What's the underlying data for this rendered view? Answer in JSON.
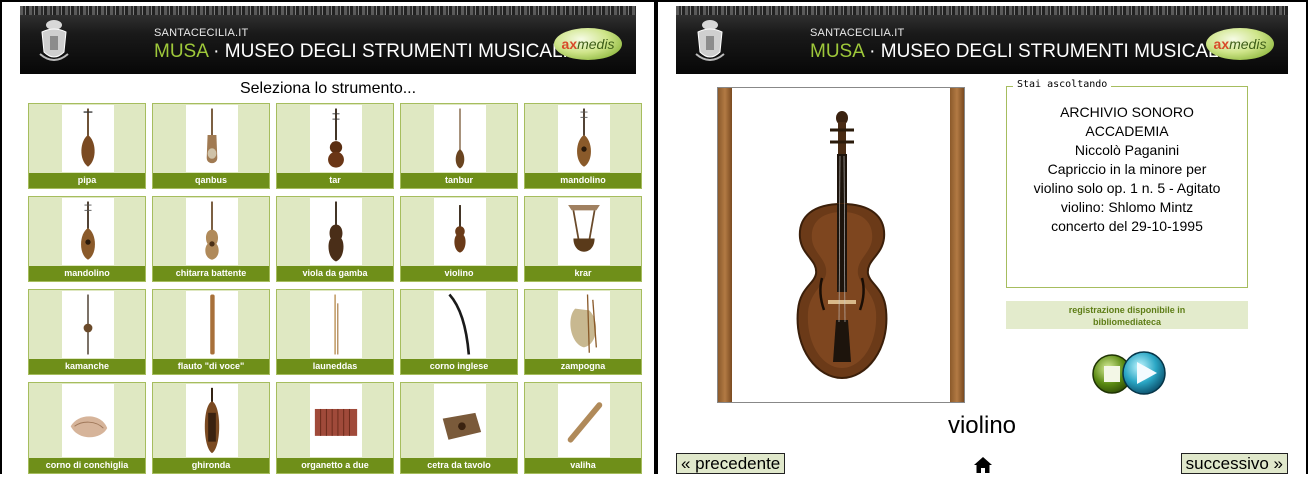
{
  "colors": {
    "tile_bg": "#dfe8c2",
    "tile_label_bg": "#6f8f19",
    "accent_green": "#9ec83a",
    "header_bg": "#111111",
    "nav_button_bg": "#e0e8cb"
  },
  "header": {
    "site": "SANTACECILIA.IT",
    "title_accent": "MUSA",
    "title_rest": " · MUSEO DEGLI STRUMENTI MUSICALI",
    "logo_x": "ax",
    "logo_rest": "medis",
    "crest_icon": "crest-icon"
  },
  "left": {
    "heading": "Seleziona lo strumento...",
    "instruments": [
      {
        "label": "pipa",
        "icon": "pipa-icon"
      },
      {
        "label": "qanbus",
        "icon": "qanbus-icon"
      },
      {
        "label": "tar",
        "icon": "tar-icon"
      },
      {
        "label": "tanbur",
        "icon": "tanbur-icon"
      },
      {
        "label": "mandolino",
        "icon": "mandolino-icon"
      },
      {
        "label": "mandolino",
        "icon": "mandolino-icon"
      },
      {
        "label": "chitarra battente",
        "icon": "chitarra-battente-icon"
      },
      {
        "label": "viola da gamba",
        "icon": "viola-da-gamba-icon"
      },
      {
        "label": "violino",
        "icon": "violino-icon"
      },
      {
        "label": "krar",
        "icon": "krar-icon"
      },
      {
        "label": "kamanche",
        "icon": "kamanche-icon"
      },
      {
        "label": "flauto \"di voce\"",
        "icon": "flauto-icon"
      },
      {
        "label": "launeddas",
        "icon": "launeddas-icon"
      },
      {
        "label": "corno inglese",
        "icon": "corno-inglese-icon"
      },
      {
        "label": "zampogna",
        "icon": "zampogna-icon"
      },
      {
        "label": "corno di conchiglia",
        "icon": "conchiglia-icon"
      },
      {
        "label": "ghironda",
        "icon": "ghironda-icon"
      },
      {
        "label": "organetto a due",
        "icon": "organetto-icon"
      },
      {
        "label": "cetra da tavolo",
        "icon": "cetra-icon"
      },
      {
        "label": "valiha",
        "icon": "valiha-icon"
      }
    ]
  },
  "right": {
    "listening_legend": "Stai ascoltando",
    "listening_lines": [
      "ARCHIVIO SONORO",
      "ACCADEMIA",
      "Niccolò Paganini",
      "Capriccio in la minore per",
      "violino solo op. 1 n. 5 - Agitato",
      "violino: Shlomo Mintz",
      "concerto del 29-10-1995"
    ],
    "availability_line1": "registrazione disponibile in",
    "availability_line2": "bibliomediateca",
    "instrument_name": "violino",
    "photo_icon": "violin-photo",
    "nav": {
      "prev": "« precedente",
      "next": "successivo »",
      "home_icon": "home-icon"
    },
    "player": {
      "stop_icon": "stop-icon",
      "play_icon": "play-icon"
    }
  }
}
